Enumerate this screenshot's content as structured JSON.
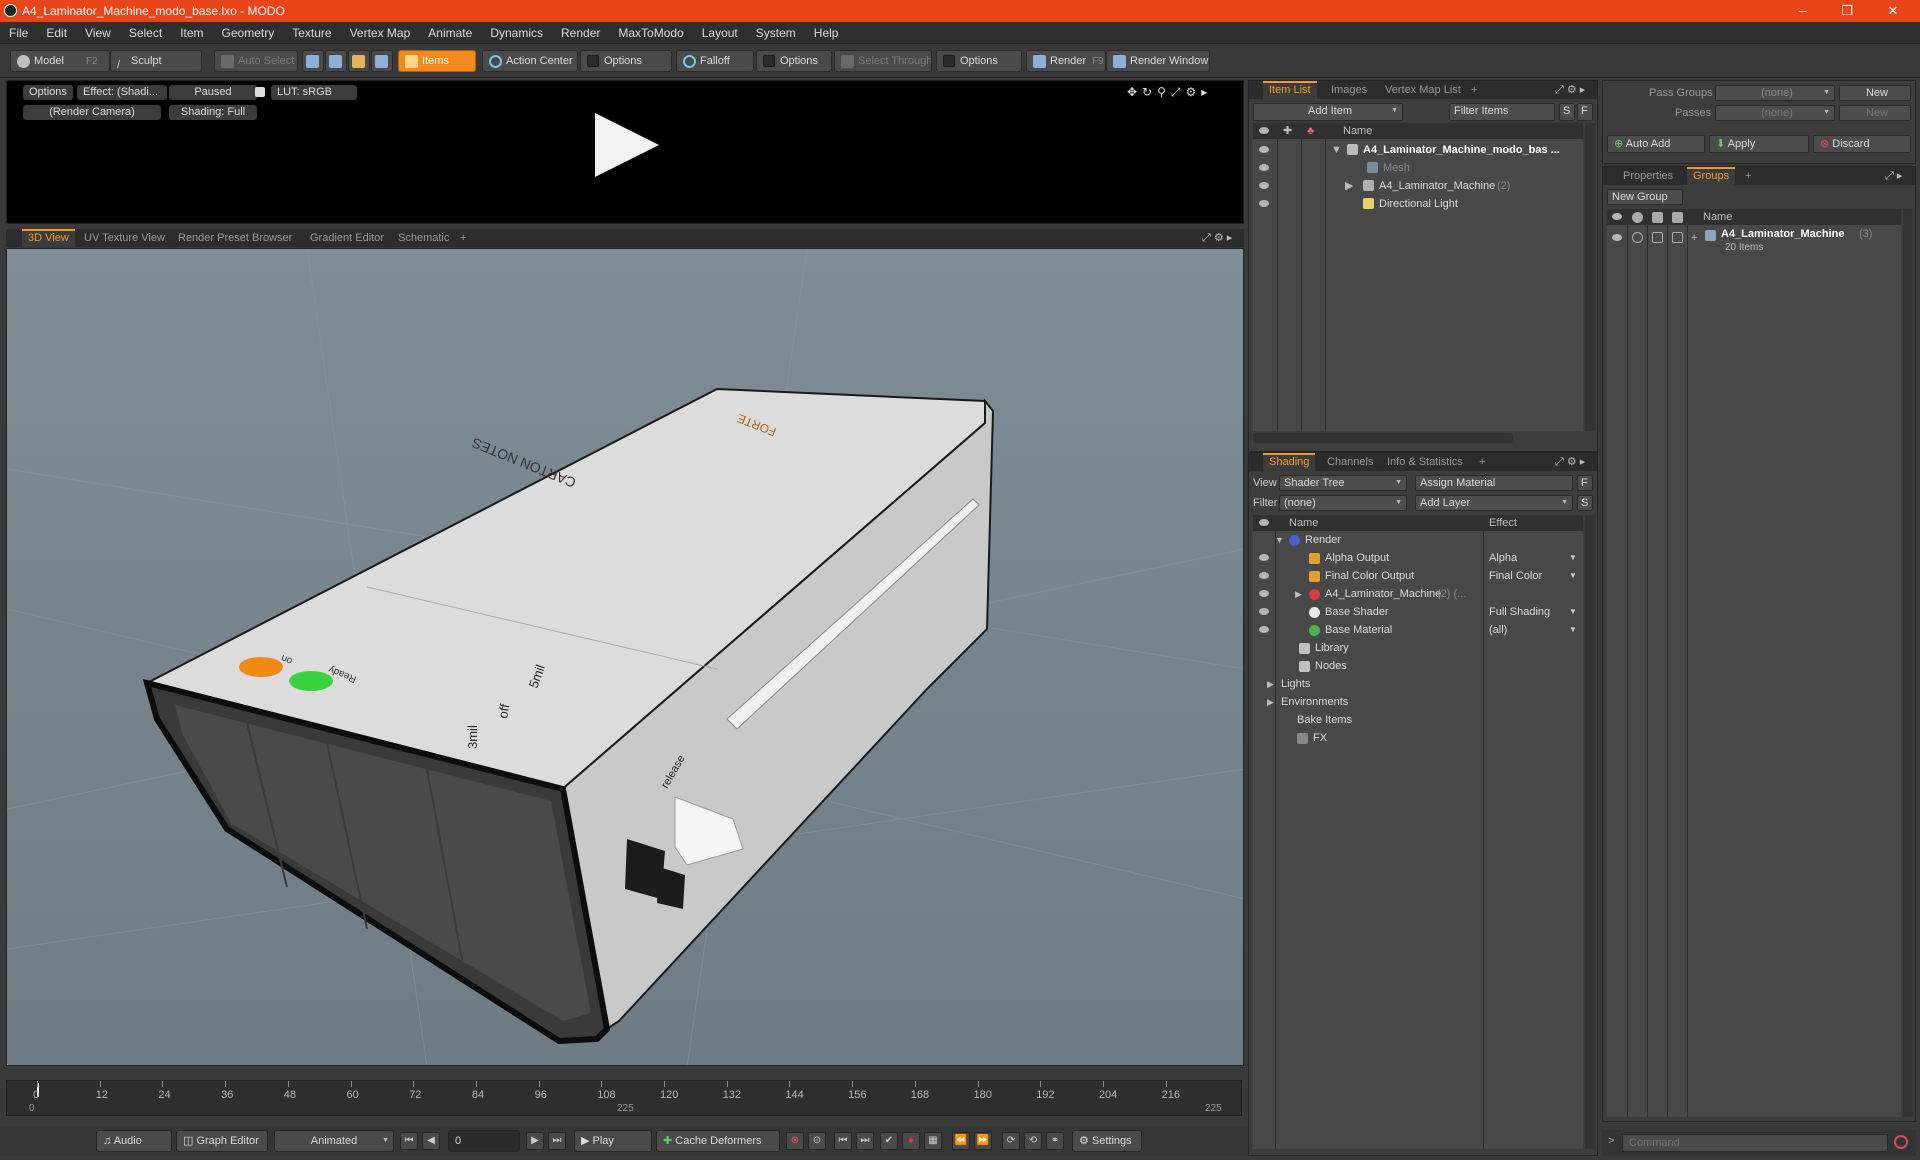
{
  "window": {
    "title": "A4_Laminator_Machine_modo_base.lxo - MODO"
  },
  "menu": [
    "File",
    "Edit",
    "View",
    "Select",
    "Item",
    "Geometry",
    "Texture",
    "Vertex Map",
    "Animate",
    "Dynamics",
    "Render",
    "MaxToModo",
    "Layout",
    "System",
    "Help"
  ],
  "toolbar": {
    "model": "Model",
    "model_key": "F2",
    "sculpt": "Sculpt",
    "auto_select": "Auto Select",
    "items": "Items",
    "action_center": "Action Center",
    "options1": "Options",
    "falloff": "Falloff",
    "options2": "Options",
    "select_through": "Select Through",
    "options3": "Options",
    "render": "Render",
    "render_key": "F9",
    "render_window": "Render Window"
  },
  "preview": {
    "options": "Options",
    "effect": "Effect: (Shadi...",
    "paused": "Paused",
    "lut": "LUT: sRGB",
    "camera": "(Render Camera)",
    "shading": "Shading: Full"
  },
  "viewport_tabs": [
    "3D View",
    "UV Texture View",
    "Render Preset Browser",
    "Gradient Editor",
    "Schematic",
    "+"
  ],
  "model_labels": {
    "brand": "CARTON\nNOTES",
    "model": "FORTE",
    "ready": "Ready",
    "on": "on",
    "speed1": "3mil",
    "speed2": "off",
    "speed3": "5mil",
    "release": "release"
  },
  "timeline": {
    "ticks": [
      "0",
      "12",
      "24",
      "36",
      "48",
      "60",
      "72",
      "84",
      "96",
      "108",
      "120",
      "132",
      "144",
      "156",
      "168",
      "180",
      "192",
      "204",
      "216"
    ],
    "start": "0",
    "mid": "225",
    "end": "225"
  },
  "transport": {
    "audio": "Audio",
    "graph_editor": "Graph Editor",
    "animated": "Animated",
    "frame": "0",
    "play": "Play",
    "cache": "Cache Deformers",
    "settings": "Settings"
  },
  "item_list": {
    "tabs": [
      "Item List",
      "Images",
      "Vertex Map List",
      "+"
    ],
    "add_item": "Add Item",
    "filter": "Filter Items",
    "s": "S",
    "f": "F",
    "col_name": "Name",
    "rows": [
      {
        "label": "A4_Laminator_Machine_modo_bas ...",
        "bold": true
      },
      {
        "label": "Mesh",
        "dim": true
      },
      {
        "label": "A4_Laminator_Machine",
        "count": "(2)"
      },
      {
        "label": "Directional Light"
      }
    ]
  },
  "shading": {
    "tabs": [
      "Shading",
      "Channels",
      "Info & Statistics",
      "+"
    ],
    "view_label": "View",
    "view_value": "Shader Tree",
    "assign": "Assign Material",
    "f": "F",
    "filter_label": "Filter",
    "filter_value": "(none)",
    "add_layer": "Add Layer",
    "s": "S",
    "col_name": "Name",
    "col_effect": "Effect",
    "rows": [
      {
        "label": "Render",
        "effect": ""
      },
      {
        "label": "Alpha Output",
        "effect": "Alpha"
      },
      {
        "label": "Final Color Output",
        "effect": "Final Color"
      },
      {
        "label": "A4_Laminator_Machine",
        "extra": "(2) (...",
        "effect": ""
      },
      {
        "label": "Base Shader",
        "effect": "Full Shading"
      },
      {
        "label": "Base Material",
        "effect": "(all)"
      },
      {
        "label": "Library",
        "effect": ""
      },
      {
        "label": "Nodes",
        "effect": ""
      },
      {
        "label": "Lights",
        "effect": ""
      },
      {
        "label": "Environments",
        "effect": ""
      },
      {
        "label": "Bake Items",
        "effect": ""
      },
      {
        "label": "FX",
        "effect": ""
      }
    ]
  },
  "right": {
    "pass_groups_label": "Pass Groups",
    "pass_groups_value": "(none)",
    "new1": "New",
    "passes_label": "Passes",
    "passes_value": "(none)",
    "new2": "New",
    "auto_add": "Auto Add",
    "apply": "Apply",
    "discard": "Discard",
    "tabs": [
      "Properties",
      "Groups",
      "+"
    ],
    "new_group": "New Group",
    "col_name": "Name",
    "group_name": "A4_Laminator_Machine",
    "group_count": "(3)",
    "group_items": "20 Items"
  },
  "command": {
    "placeholder": "Command"
  },
  "colors": {
    "accent": "#f39a2a",
    "titlebar": "#e8451a",
    "led_orange": "#f08a14",
    "led_green": "#3ad23a"
  }
}
